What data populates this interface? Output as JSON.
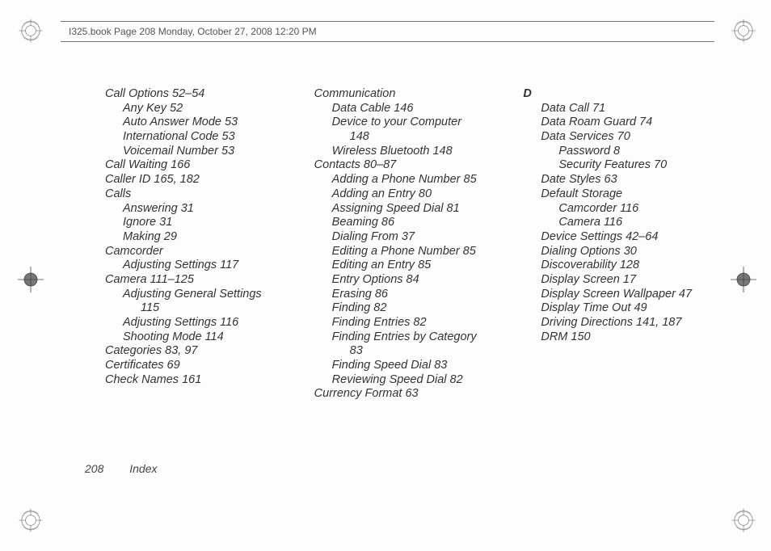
{
  "header": "I325.book  Page 208  Monday, October 27, 2008  12:20 PM",
  "footer": {
    "page": "208",
    "label": "Index"
  },
  "col1": [
    [
      "Call Options 52–54",
      0
    ],
    [
      "Any Key 52",
      1
    ],
    [
      "Auto Answer Mode 53",
      1
    ],
    [
      "International Code 53",
      1
    ],
    [
      "Voicemail Number 53",
      1
    ],
    [
      "Call Waiting 166",
      0
    ],
    [
      "Caller ID 165, 182",
      0
    ],
    [
      "Calls",
      0
    ],
    [
      "Answering 31",
      1
    ],
    [
      "Ignore 31",
      1
    ],
    [
      "Making 29",
      1
    ],
    [
      "Camcorder",
      0
    ],
    [
      "Adjusting Settings 117",
      1
    ],
    [
      "Camera 111–125",
      0
    ],
    [
      "Adjusting General Settings",
      1
    ],
    [
      "115",
      2
    ],
    [
      "Adjusting Settings 116",
      1
    ],
    [
      "Shooting Mode 114",
      1
    ],
    [
      "Categories 83, 97",
      0
    ],
    [
      "Certificates 69",
      0
    ],
    [
      "Check Names 161",
      0
    ]
  ],
  "col2": [
    [
      "Communication",
      0
    ],
    [
      "Data Cable 146",
      1
    ],
    [
      "Device to your Computer",
      1
    ],
    [
      "148",
      2
    ],
    [
      "Wireless Bluetooth 148",
      1
    ],
    [
      "Contacts 80–87",
      0
    ],
    [
      "Adding a Phone Number 85",
      1
    ],
    [
      "Adding an Entry 80",
      1
    ],
    [
      "Assigning Speed Dial 81",
      1
    ],
    [
      "Beaming 86",
      1
    ],
    [
      "Dialing From 37",
      1
    ],
    [
      "Editing a Phone Number 85",
      1
    ],
    [
      "Editing an Entry 85",
      1
    ],
    [
      "Entry Options 84",
      1
    ],
    [
      "Erasing 86",
      1
    ],
    [
      "Finding 82",
      1
    ],
    [
      "Finding Entries 82",
      1
    ],
    [
      "Finding Entries by Category",
      1
    ],
    [
      "83",
      2
    ],
    [
      "Finding Speed Dial 83",
      1
    ],
    [
      "Reviewing Speed Dial 82",
      1
    ],
    [
      "Currency Format 63",
      0
    ]
  ],
  "col3": [
    [
      "D",
      0,
      true
    ],
    [
      "Data Call 71",
      1
    ],
    [
      "Data Roam Guard 74",
      1
    ],
    [
      "Data Services 70",
      1
    ],
    [
      "Password 8",
      2
    ],
    [
      "Security Features 70",
      2
    ],
    [
      "Date Styles 63",
      1
    ],
    [
      "Default Storage",
      1
    ],
    [
      "Camcorder 116",
      2
    ],
    [
      "Camera 116",
      2
    ],
    [
      "Device Settings 42–64",
      1
    ],
    [
      "Dialing Options 30",
      1
    ],
    [
      "Discoverability 128",
      1
    ],
    [
      "Display Screen 17",
      1
    ],
    [
      "Display Screen Wallpaper 47",
      1
    ],
    [
      "Display Time Out 49",
      1
    ],
    [
      "Driving Directions 141, 187",
      1
    ],
    [
      "DRM 150",
      1
    ]
  ]
}
